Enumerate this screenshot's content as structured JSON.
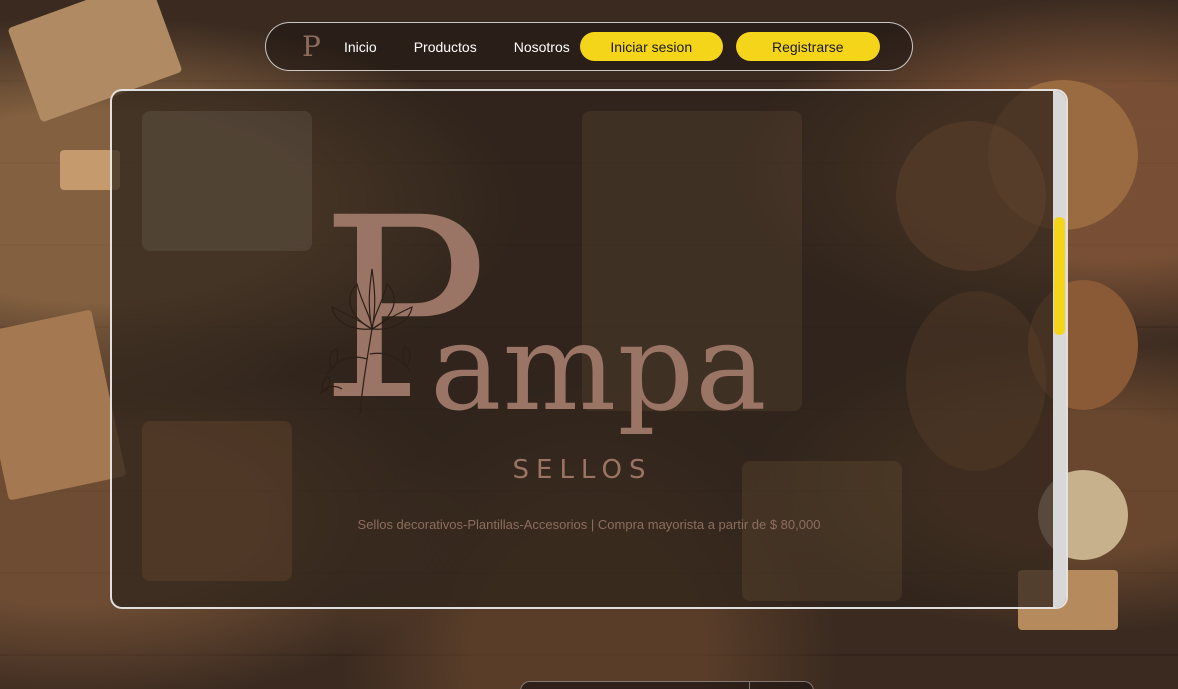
{
  "nav": {
    "logo_letter": "P",
    "links": [
      "Inicio",
      "Productos",
      "Nosotros"
    ],
    "login_label": "Iniciar sesion",
    "register_label": "Registrarse"
  },
  "hero": {
    "brand_initial": "P",
    "brand_rest": "ampa",
    "subtitle": "SELLOS",
    "tagline": "Sellos decorativos-Plantillas-Accesorios | Compra mayorista a partir de $ 80,000"
  },
  "colors": {
    "accent": "#f5d51a",
    "brand": "#9a7464"
  }
}
